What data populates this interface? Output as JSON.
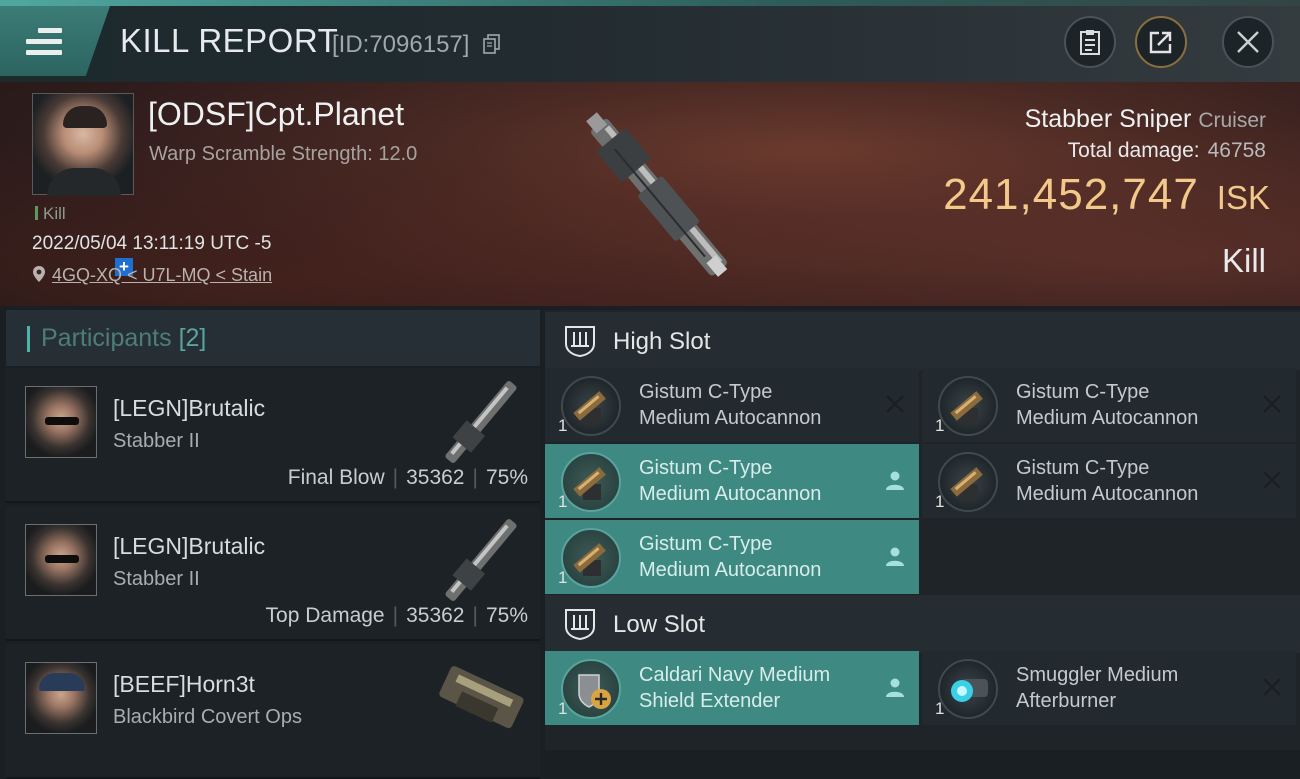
{
  "header": {
    "title": "KILL REPORT",
    "report_id": "[ID:7096157]"
  },
  "victim": {
    "name": "[ODSF]Cpt.Planet",
    "warp_strength": "Warp Scramble Strength: 12.0",
    "tag": "Kill",
    "timestamp": "2022/05/04 13:11:19 UTC -5",
    "location": "4GQ-XQ < U7L-MQ < Stain",
    "ship_name": "Stabber Sniper",
    "ship_class": "Cruiser",
    "total_damage_label": "Total damage:",
    "total_damage": "46758",
    "isk_value": "241,452,747",
    "isk_unit": "ISK",
    "result": "Kill"
  },
  "participants": {
    "title": "Participants",
    "count": "[2]",
    "items": [
      {
        "name": "[LEGN]Brutalic",
        "ship": "Stabber II",
        "role": "Final Blow",
        "damage": "35362",
        "percent": "75%"
      },
      {
        "name": "[LEGN]Brutalic",
        "ship": "Stabber II",
        "role": "Top Damage",
        "damage": "35362",
        "percent": "75%"
      },
      {
        "name": "[BEEF]Horn3t",
        "ship": "Blackbird Covert Ops",
        "role": "",
        "damage": "",
        "percent": ""
      }
    ]
  },
  "high_slot": {
    "label": "High Slot",
    "modules": [
      {
        "name": "Gistum C-Type\nMedium Autocannon",
        "qty": "1",
        "state": "destroyed"
      },
      {
        "name": "Gistum C-Type\nMedium Autocannon",
        "qty": "1",
        "state": "destroyed"
      },
      {
        "name": "Gistum C-Type\nMedium Autocannon",
        "qty": "1",
        "state": "dropped"
      },
      {
        "name": "Gistum C-Type\nMedium Autocannon",
        "qty": "1",
        "state": "destroyed"
      },
      {
        "name": "Gistum C-Type\nMedium Autocannon",
        "qty": "1",
        "state": "dropped"
      }
    ]
  },
  "low_slot": {
    "label": "Low Slot",
    "modules": [
      {
        "name": "Caldari Navy Medium\nShield Extender",
        "qty": "1",
        "state": "dropped"
      },
      {
        "name": "Smuggler Medium\nAfterburner",
        "qty": "1",
        "state": "destroyed"
      }
    ]
  },
  "icons": [
    "menu-icon",
    "copy-icon",
    "clipboard-icon",
    "share-icon",
    "close-icon",
    "location-pin-icon",
    "plus-icon",
    "slot-icon",
    "pilot-icon",
    "x-icon"
  ]
}
